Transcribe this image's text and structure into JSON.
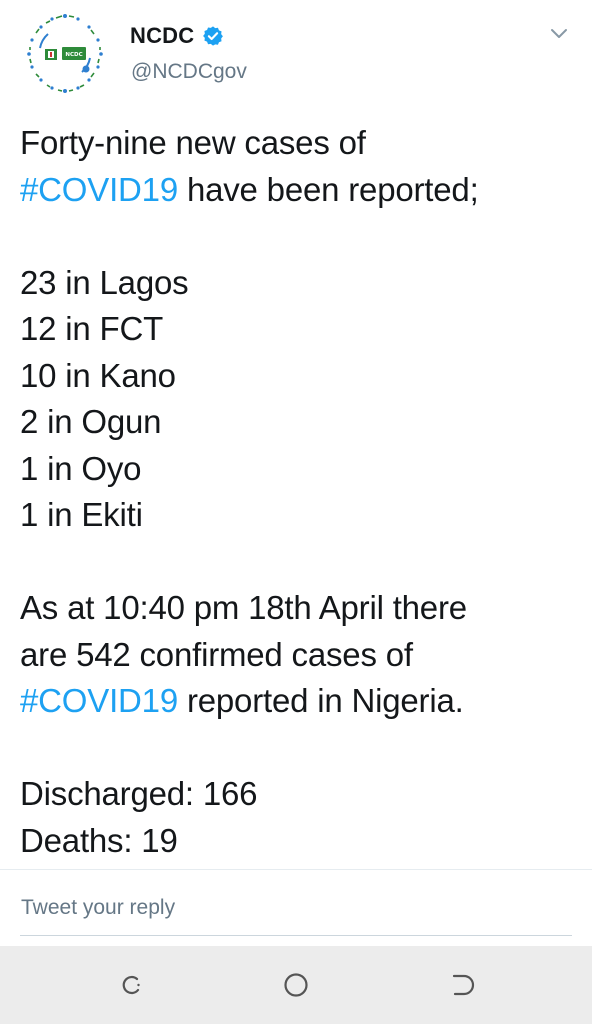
{
  "app": {
    "colors": {
      "text": "#14171a",
      "secondary": "#657786",
      "hashtag": "#1da1f2",
      "verified": "#1da1f2",
      "logo_green": "#2e8b3a",
      "navbar_bg": "#ececec"
    }
  },
  "header": {
    "display_name": "NCDC",
    "handle": "@NCDCgov",
    "avatar_text": "NCDC",
    "verified_icon": "verified-badge-icon",
    "menu_icon": "chevron-down-icon"
  },
  "tweet": {
    "l1": "Forty-nine new cases of",
    "l2_tag": "#COVID19",
    "l2_rest": " have been reported;",
    "cases": [
      "23 in Lagos",
      "12 in FCT",
      "10 in Kano",
      "2 in Ogun",
      "1 in Oyo",
      "1 in Ekiti"
    ],
    "s1": "As at 10:40 pm 18th April there",
    "s2": "are 542 confirmed cases of",
    "s3_tag": "#COVID19",
    "s3_rest": " reported in Nigeria.",
    "discharged": "Discharged: 166",
    "deaths": "Deaths: 19"
  },
  "reply": {
    "placeholder": "Tweet your reply"
  },
  "navbar": {
    "recent_icon": "recent-apps-icon",
    "home_icon": "home-icon",
    "back_icon": "back-icon"
  }
}
